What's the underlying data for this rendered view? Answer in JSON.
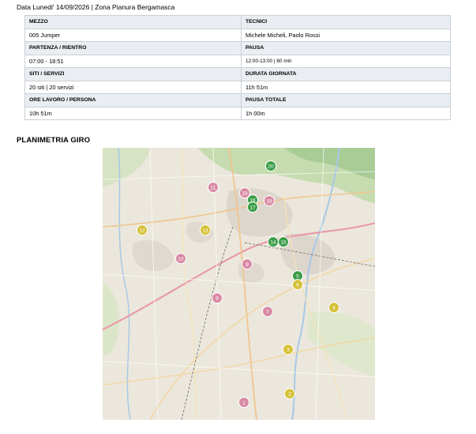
{
  "header": {
    "text": "Data Lunedi' 14/09/2026 | Zona Pianura Bergamasca"
  },
  "info": {
    "rows": [
      {
        "left_label": "MEZZO",
        "left_value": "005 Jumper",
        "right_label": "TECNICI",
        "right_value": "Michele Micheli, Paolo Rossi"
      },
      {
        "left_label": "PARTENZA / RIENTRO",
        "left_value": "07:00 - 18:51",
        "right_label": "PAUSA",
        "right_value": "12:00-13:00 | 60 min"
      },
      {
        "left_label": "SITI / SERVIZI",
        "left_value": "20 siti | 20 servizi",
        "right_label": "DURATA GIORNATA",
        "right_value": "11h 51m"
      },
      {
        "left_label": "ORE LAVORO / PERSONA",
        "left_value": "10h 51m",
        "right_label": "PAUSA TOTALE",
        "right_value": "1h 00m"
      }
    ]
  },
  "map_section": {
    "title": "PLANIMETRIA GIRO"
  },
  "markers": [
    {
      "label": "1",
      "color": "#d98aa5"
    },
    {
      "label": "2",
      "color": "#d6c13a"
    },
    {
      "label": "3",
      "color": "#d6c13a"
    },
    {
      "label": "4",
      "color": "#d6c13a"
    },
    {
      "label": "5",
      "color": "#3a9e47"
    },
    {
      "label": "6",
      "color": "#d6c13a"
    },
    {
      "label": "7",
      "color": "#d98aa5"
    },
    {
      "label": "8",
      "color": "#d98aa5"
    },
    {
      "label": "9",
      "color": "#d98aa5"
    },
    {
      "label": "10",
      "color": "#d98aa5"
    },
    {
      "label": "11",
      "color": "#d98aa5"
    },
    {
      "label": "12",
      "color": "#d6c13a"
    },
    {
      "label": "13",
      "color": "#d6c13a"
    },
    {
      "label": "14",
      "color": "#3a9e47"
    },
    {
      "label": "15",
      "color": "#3a9e47"
    },
    {
      "label": "16",
      "color": "#3a9e47"
    },
    {
      "label": "17",
      "color": "#3a9e47"
    },
    {
      "label": "18",
      "color": "#d98aa5"
    },
    {
      "label": "19",
      "color": "#d98aa5"
    },
    {
      "label": "20",
      "color": "#3a9e47"
    }
  ]
}
